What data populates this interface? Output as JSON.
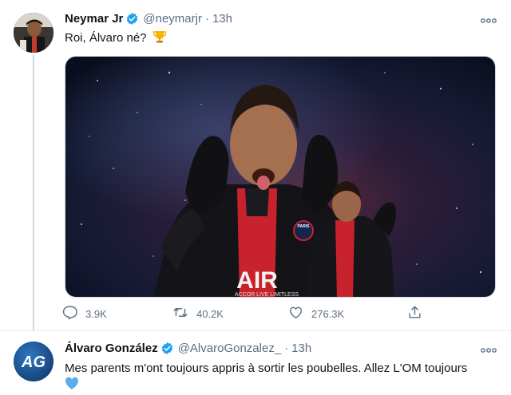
{
  "tweet1": {
    "author_name": "Neymar Jr",
    "handle": "@neymarjr",
    "separator": "·",
    "time": "13h",
    "text": "Roi, Álvaro né?",
    "replies": "3.9K",
    "retweets": "40.2K",
    "likes": "276.3K",
    "image_text": {
      "sponsor": "AIR",
      "sponsor_sub": "ACCOR LIVE LIMITLESS",
      "crest": "PARIS"
    }
  },
  "tweet2": {
    "author_name": "Álvaro González",
    "handle": "@AlvaroGonzalez_",
    "separator": "·",
    "time": "13h",
    "text": "Mes parents m'ont toujours appris à sortir les poubelles. Allez L'OM toujours",
    "avatar_initials": "AG"
  },
  "icons": {
    "verified": "verified-badge-icon",
    "more": "more-options-icon",
    "reply": "reply-icon",
    "retweet": "retweet-icon",
    "like": "heart-icon",
    "share": "share-icon",
    "trophy": "trophy-emoji",
    "blue_heart": "blue-heart-emoji"
  },
  "colors": {
    "verified_blue": "#1da1f2",
    "muted_text": "#5b7083",
    "heart_blue": "#5dadec",
    "trophy_gold": "#f4b400"
  }
}
